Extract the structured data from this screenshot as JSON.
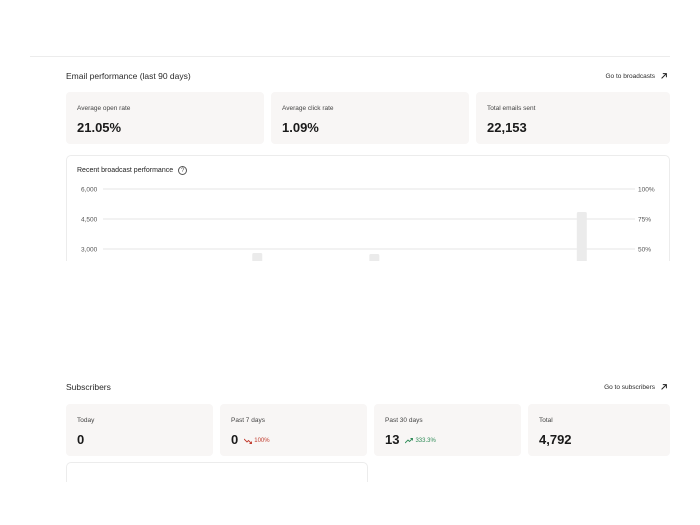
{
  "email_performance": {
    "title": "Email performance (last 90 days)",
    "link_label": "Go to broadcasts",
    "cards": [
      {
        "label": "Average open rate",
        "value": "21.05%"
      },
      {
        "label": "Average click rate",
        "value": "1.09%"
      },
      {
        "label": "Total emails sent",
        "value": "22,153"
      }
    ]
  },
  "recent_broadcast": {
    "title": "Recent broadcast performance",
    "left_ticks": [
      "6,000",
      "4,500",
      "3,000"
    ],
    "right_ticks": [
      "100%",
      "75%",
      "50%"
    ]
  },
  "chart_data": {
    "type": "bar",
    "title": "Recent broadcast performance",
    "left_axis": {
      "ticks": [
        6000,
        4500,
        3000
      ]
    },
    "right_axis": {
      "ticks": [
        "100%",
        "75%",
        "50%"
      ]
    },
    "ylim_visible": [
      3000,
      6000
    ],
    "bars": [
      {
        "position": 0.29,
        "value": 2800
      },
      {
        "position": 0.51,
        "value": 2750
      },
      {
        "position": 0.9,
        "value": 4850
      }
    ]
  },
  "subscribers": {
    "title": "Subscribers",
    "link_label": "Go to subscribers",
    "cards": [
      {
        "label": "Today",
        "value": "0",
        "trend": ""
      },
      {
        "label": "Past 7 days",
        "value": "0",
        "trend": "100%",
        "trend_dir": "down"
      },
      {
        "label": "Past 30 days",
        "value": "13",
        "trend": "333.3%",
        "trend_dir": "up"
      },
      {
        "label": "Total",
        "value": "4,792",
        "trend": ""
      }
    ],
    "colors": {
      "down": "#c0392b",
      "up": "#2e8b57"
    }
  }
}
